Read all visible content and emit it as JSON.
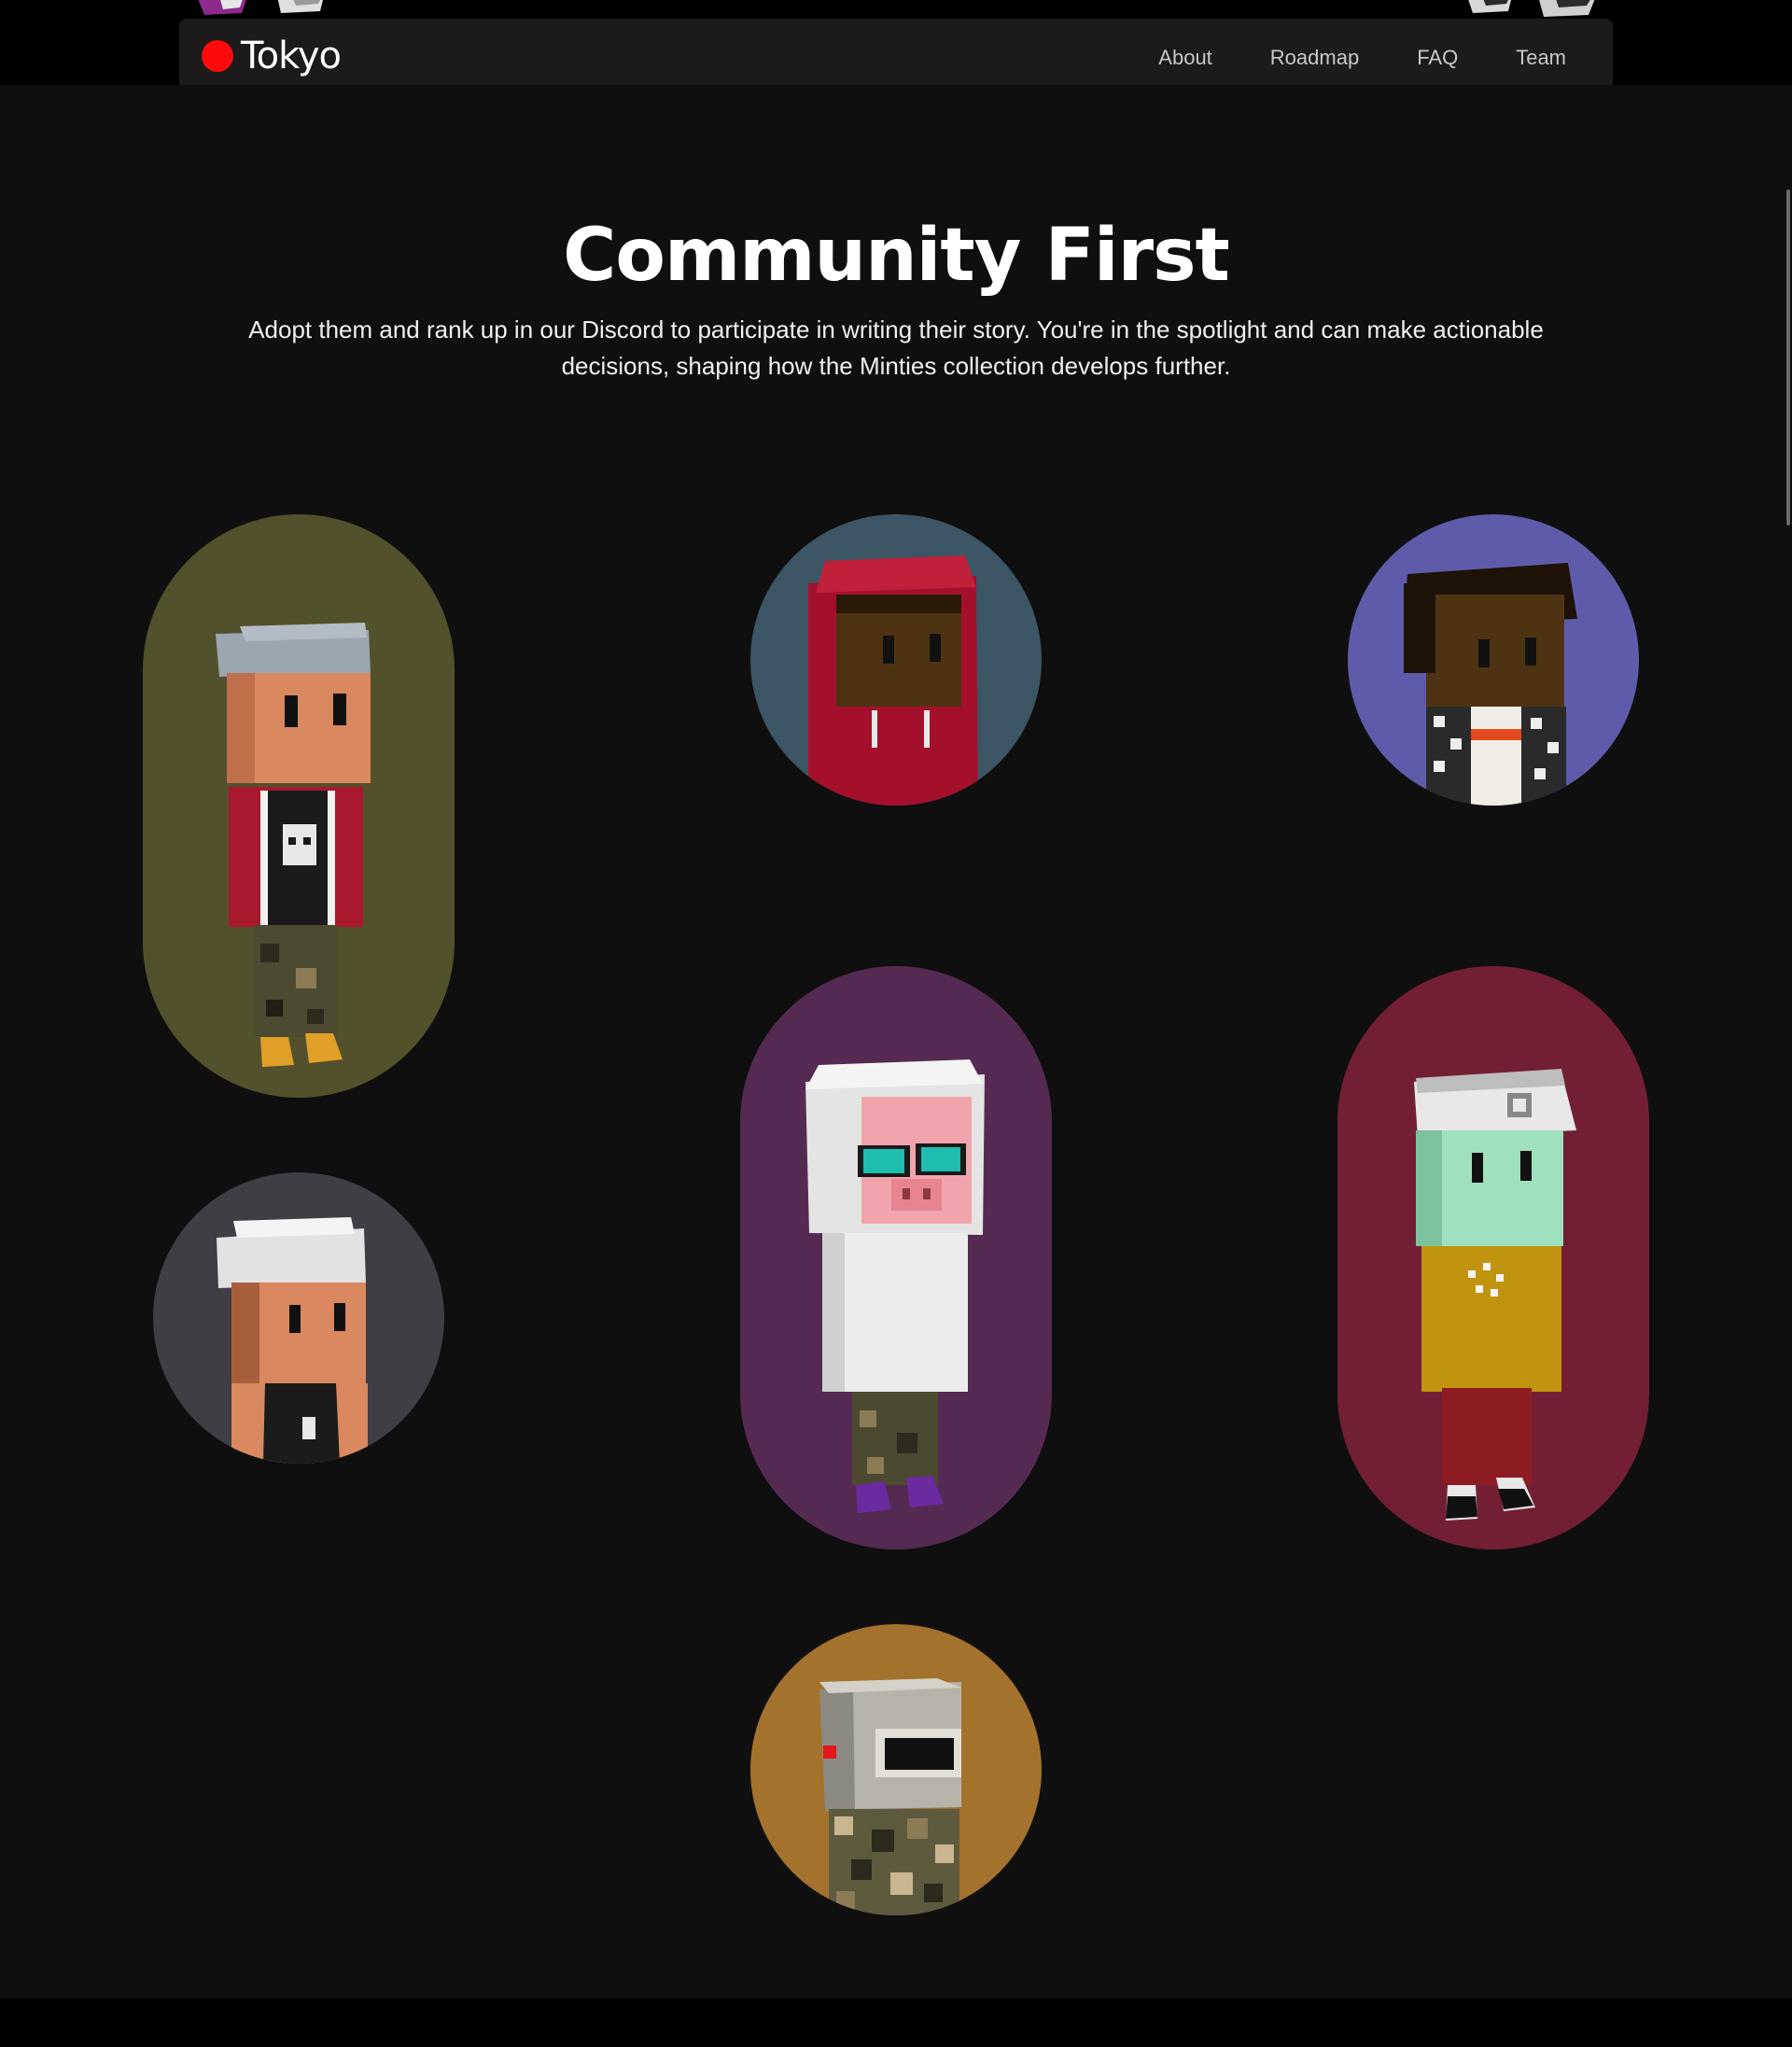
{
  "brand": {
    "name": "Tokyo",
    "dot_color": "#ff0a0a",
    "icon": "red-dot-logo-icon"
  },
  "nav": {
    "items": [
      {
        "label": "About"
      },
      {
        "label": "Roadmap"
      },
      {
        "label": "FAQ"
      },
      {
        "label": "Team"
      }
    ]
  },
  "hero": {
    "title": "Community First",
    "description": "Adopt them and rank up in our Discord to participate in writing their story. You're in the spotlight and can make actionable decisions, shaping how the Minties collection develops further."
  },
  "avatars": [
    {
      "name": "avatar-grey-cap-skull-tee",
      "bg": "#52512b"
    },
    {
      "name": "avatar-red-hoodie",
      "bg": "#3c5666"
    },
    {
      "name": "avatar-curly-hair-checkered-jacket",
      "bg": "#5e5caa"
    },
    {
      "name": "avatar-white-cap-jersey",
      "bg": "#3e3e44"
    },
    {
      "name": "avatar-pig-white-hoodie",
      "bg": "#542a52"
    },
    {
      "name": "avatar-green-face-yellow-tee",
      "bg": "#721f34"
    },
    {
      "name": "avatar-robot-camo",
      "bg": "#a3722c"
    }
  ],
  "colors": {
    "page_bg": "#0f0f0f",
    "navbar_bg": "#1b1b1b",
    "text": "#ffffff",
    "nav_text": "#c8c8c8"
  }
}
